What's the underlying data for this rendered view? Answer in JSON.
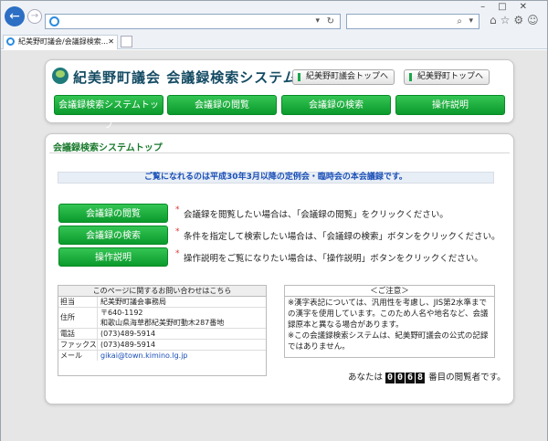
{
  "browser": {
    "tab_title": "紀美野町議会/会議録検索...",
    "window_controls": [
      "–",
      "□",
      "✕"
    ]
  },
  "header": {
    "site_title": "紀美野町議会  会議録検索システム",
    "link_top_council": "紀美野町議会トップへ",
    "link_top_town": "紀美野町トップへ",
    "menu": [
      "会議録検索システムトップ",
      "会議録の閲覧",
      "会議録の検索",
      "操作説明"
    ]
  },
  "main": {
    "section_title": "会議録検索システムトップ",
    "notice": "ご覧になれるのは平成30年3月以降の定例会・臨時会の本会議録です。",
    "actions": [
      {
        "label": "会議録の閲覧",
        "desc": "会議録を閲覧したい場合は、「会議録の閲覧」をクリックください。"
      },
      {
        "label": "会議録の検索",
        "desc": "条件を指定して検索したい場合は、「会議録の検索」ボタンをクリックください。"
      },
      {
        "label": "操作説明",
        "desc": "操作説明をご覧になりたい場合は、「操作説明」ボタンをクリックください。"
      }
    ]
  },
  "contact": {
    "heading": "このページに関するお問い合わせはこちら",
    "rows": [
      {
        "key": "担当",
        "value": "紀美野町議会事務局"
      },
      {
        "key": "住所",
        "value": "〒640-1192",
        "value2": "和歌山県海草郡紀美野町動木287番地"
      },
      {
        "key": "電話",
        "value": "(073)489-5914"
      },
      {
        "key": "ファックス",
        "value": "(073)489-5914"
      },
      {
        "key": "メール",
        "value": "gikai@town.kimino.lg.jp"
      }
    ]
  },
  "caution": {
    "heading": "＜ご注意＞",
    "line1": "※漢字表記については、汎用性を考慮し、JIS第2水準までの漢字を使用しています。このため人名や地名など、会議録原本と異なる場合があります。",
    "line2": "※この会議録検索システムは、紀美野町議会の公式の記録ではありません。"
  },
  "counter": {
    "prefix": "あなたは",
    "digits": [
      "0",
      "0",
      "6",
      "8"
    ],
    "suffix": "番目の閲覧者です。"
  }
}
